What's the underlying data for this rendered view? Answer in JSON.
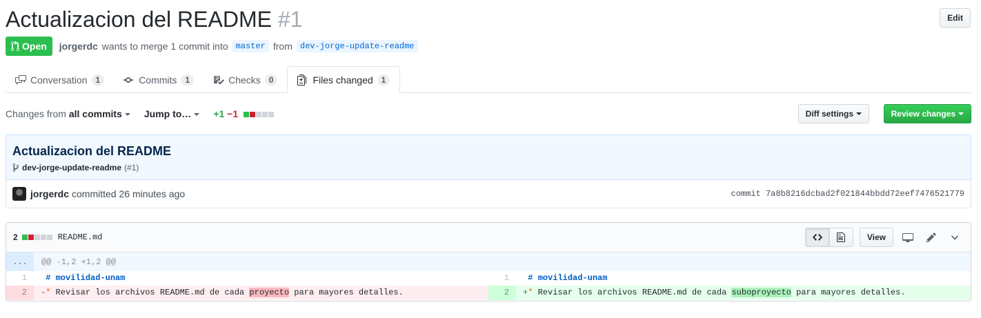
{
  "pr": {
    "title": "Actualizacion del README",
    "number": "#1",
    "edit_label": "Edit",
    "state_label": "Open",
    "author": "jorgerdc",
    "merge_text": "wants to merge 1 commit into",
    "base_branch": "master",
    "from_text": "from",
    "head_branch": "dev-jorge-update-readme"
  },
  "tabs": [
    {
      "label": "Conversation",
      "count": "1",
      "icon": "comment-discussion-icon"
    },
    {
      "label": "Commits",
      "count": "1",
      "icon": "git-commit-icon"
    },
    {
      "label": "Checks",
      "count": "0",
      "icon": "checklist-icon"
    },
    {
      "label": "Files changed",
      "count": "1",
      "icon": "file-diff-icon",
      "selected": true
    }
  ],
  "toolbar": {
    "changes_prefix": "Changes from",
    "changes_value": "all commits",
    "jump_label": "Jump to…",
    "additions": "+1",
    "deletions": "−1",
    "diff_settings_label": "Diff settings",
    "review_label": "Review changes"
  },
  "commit": {
    "title": "Actualizacion del README",
    "branch": "dev-jorge-update-readme",
    "pr_ref": "(#1)",
    "author": "jorgerdc",
    "when": "committed 26 minutes ago",
    "sha": "commit 7a8b8216dcbad2f021844bbdd72eef7476521779"
  },
  "file": {
    "change_count": "2",
    "name": "README.md",
    "view_label": "View",
    "hunk_expand": "...",
    "hunk_header": "@@ -1,2 +1,2 @@",
    "left": [
      {
        "num": "1",
        "type": "context",
        "marker": " ",
        "pre": "# movilidad-unam",
        "hl": "",
        "post": ""
      },
      {
        "num": "2",
        "type": "removed",
        "marker": "-",
        "pre": "Revisar los archivos README.md de cada ",
        "hl": "proyecto",
        "post": " para mayores detalles."
      }
    ],
    "right": [
      {
        "num": "1",
        "type": "context",
        "marker": " ",
        "pre": "# movilidad-unam",
        "hl": "",
        "post": ""
      },
      {
        "num": "2",
        "type": "added",
        "marker": "+",
        "pre": "Revisar los archivos README.md de cada ",
        "hl": "suboproyecto",
        "post": " para mayores detalles."
      }
    ]
  },
  "colors": {
    "open_green": "#2cbe4e",
    "add_green": "#28a745",
    "del_red": "#cb2431",
    "link_blue": "#0366d6"
  }
}
